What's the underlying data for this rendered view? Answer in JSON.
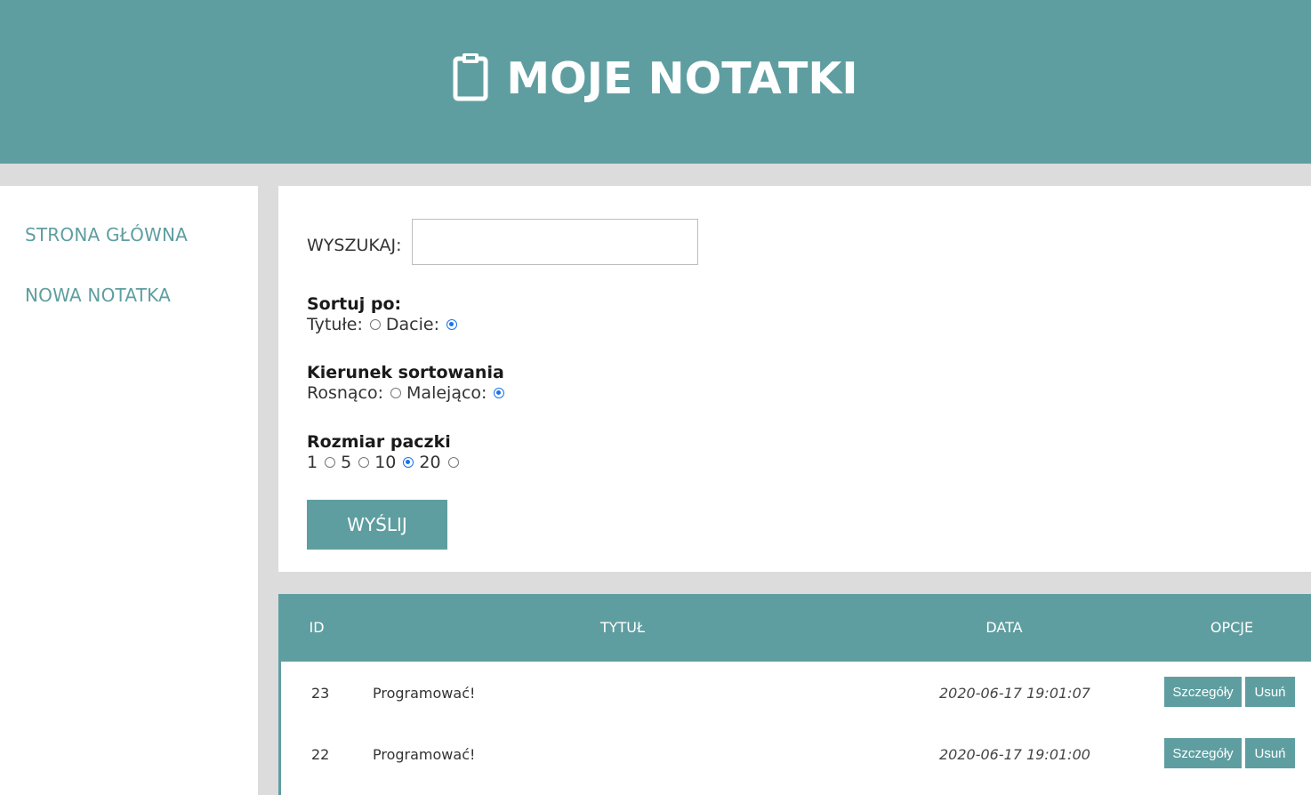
{
  "header": {
    "title": "MOJE NOTATKI",
    "icon": "clipboard-icon"
  },
  "sidebar": {
    "items": [
      {
        "label": "STRONA GŁÓWNA"
      },
      {
        "label": "NOWA NOTATKA"
      }
    ]
  },
  "form": {
    "search_label": "WYSZUKAJ:",
    "search_value": "",
    "sort_by": {
      "title": "Sortuj po:",
      "options": [
        {
          "label": "Tytułe:",
          "checked": false
        },
        {
          "label": "Dacie:",
          "checked": true
        }
      ]
    },
    "sort_direction": {
      "title": "Kierunek sortowania",
      "options": [
        {
          "label": "Rosnąco:",
          "checked": false
        },
        {
          "label": "Malejąco:",
          "checked": true
        }
      ]
    },
    "page_size": {
      "title": "Rozmiar paczki",
      "options": [
        {
          "label": "1",
          "checked": false
        },
        {
          "label": "5",
          "checked": false
        },
        {
          "label": "10",
          "checked": true
        },
        {
          "label": "20",
          "checked": false
        }
      ]
    },
    "submit_label": "WYŚLIJ"
  },
  "table": {
    "headers": {
      "id": "ID",
      "title": "TYTUŁ",
      "date": "DATA",
      "options": "OPCJE"
    },
    "rows": [
      {
        "id": "23",
        "title": "Programować!",
        "date": "2020-06-17 19:01:07",
        "details": "Szczegóły",
        "delete": "Usuń"
      },
      {
        "id": "22",
        "title": "Programować!",
        "date": "2020-06-17 19:01:00",
        "details": "Szczegóły",
        "delete": "Usuń"
      }
    ]
  },
  "colors": {
    "accent": "#5f9ea0",
    "background": "#dcdcdc",
    "radio_checked": "#1a73e8"
  }
}
